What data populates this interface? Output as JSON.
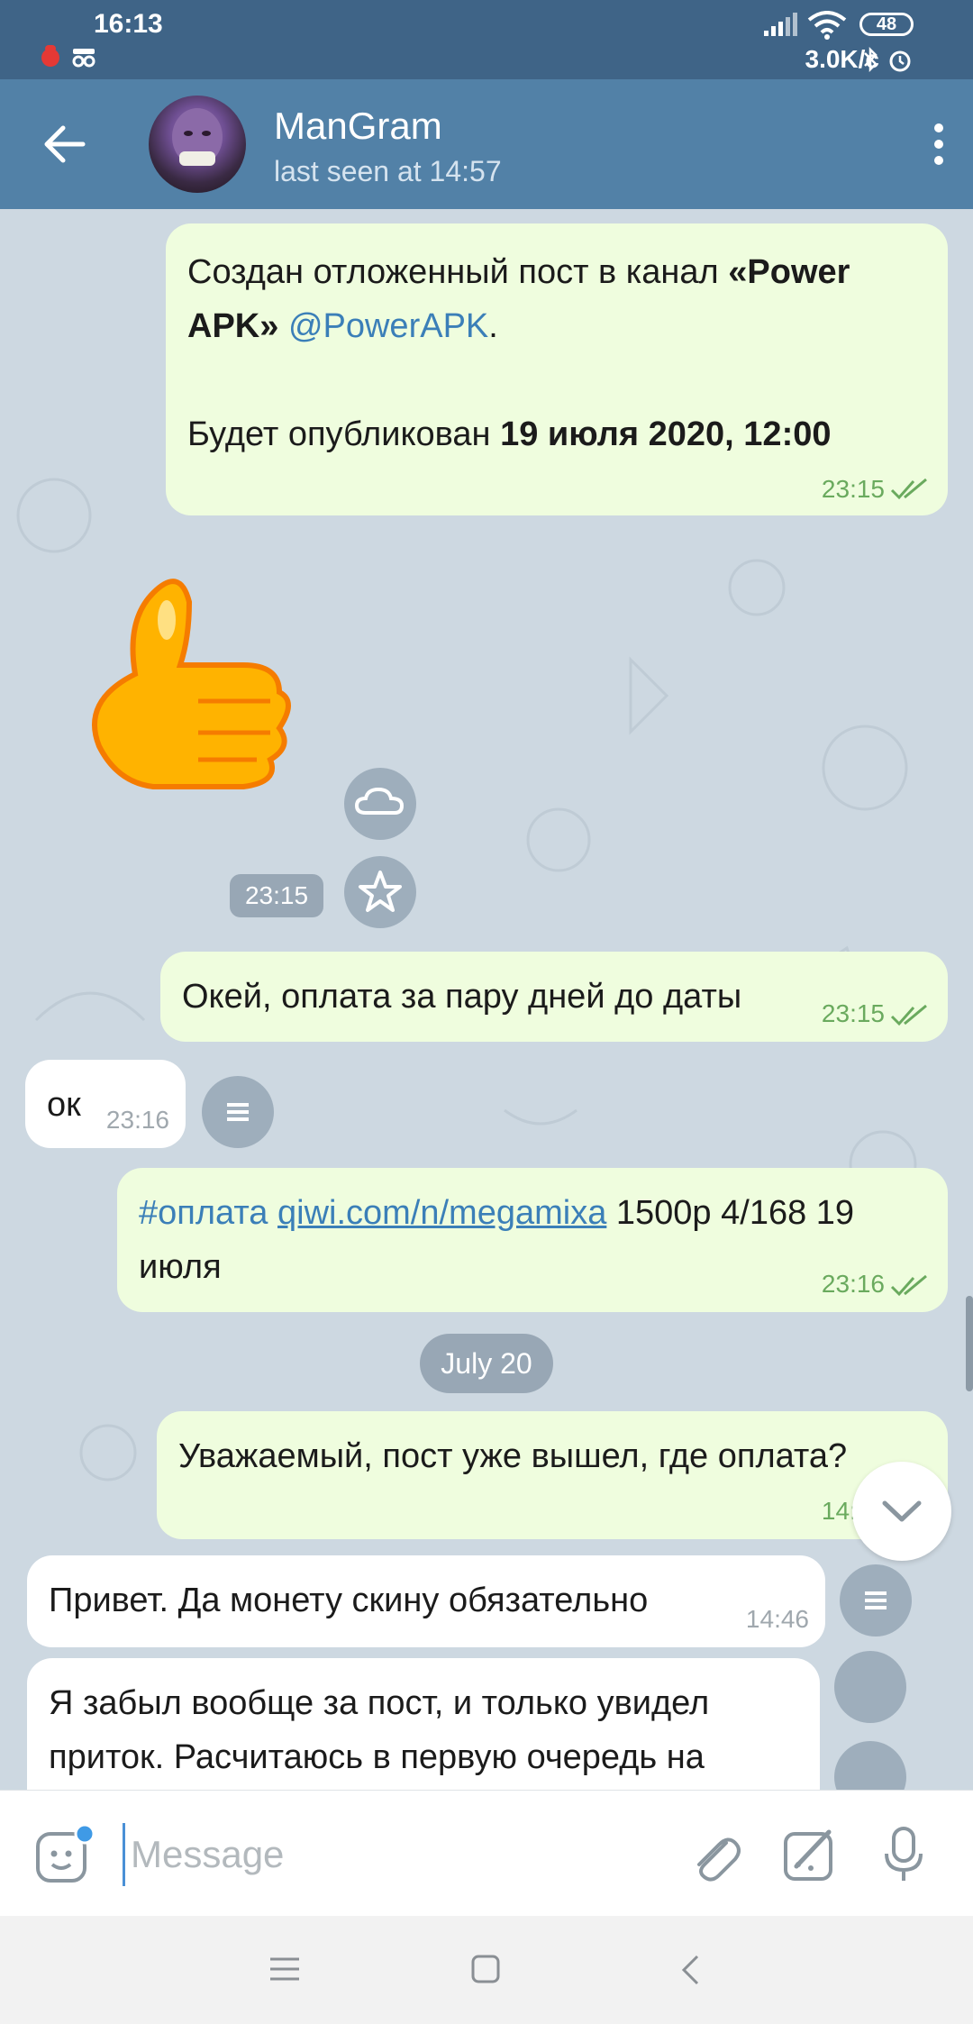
{
  "status_bar": {
    "time": "16:13",
    "speed": "3.0K/c",
    "battery": "48"
  },
  "header": {
    "title": "ManGram",
    "subtitle": "last seen at 14:57"
  },
  "messages": {
    "m1": {
      "line1_a": "Создан отложенный пост в канал ",
      "line1_b": "«Power",
      "line2_a": "APK»",
      "line2_link": "@PowerAPK",
      "line2_dot": ".",
      "line3_a": "Будет опубликован ",
      "line3_b": "19 ",
      "line3_c": "июля",
      "line3_d": " 2020, 12:00",
      "time": "23:15"
    },
    "sticker": {
      "time": "23:15"
    },
    "m2": {
      "text": "Окей, оплата за пару дней до даты",
      "time": "23:15"
    },
    "m3": {
      "text": "ок",
      "time": "23:16"
    },
    "m4": {
      "hashtag": "#оплата",
      "link": "qiwi.com/n/megamixa",
      "rest": " 1500р 4/168 19",
      "line2": "июля",
      "time": "23:16"
    },
    "date_separator": "July 20",
    "m5": {
      "text": "Уважаемый, пост уже вышел, где оплата?",
      "time": "14:44"
    },
    "m6": {
      "text": "Привет. Да монету скину обязательно",
      "time": "14:46"
    },
    "m7": {
      "line1": "Я забыл вообще за пост, и только увидел",
      "line2": "приток. Расчитаюсь в первую очередь на"
    }
  },
  "composer": {
    "placeholder": "Message"
  },
  "colors": {
    "header": "#5281a7",
    "statusbar": "#3f6487",
    "outgoing_bubble": "#effdde",
    "incoming_bubble": "#ffffff",
    "link": "#3b7fb8",
    "time_out": "#6aaa5e"
  }
}
